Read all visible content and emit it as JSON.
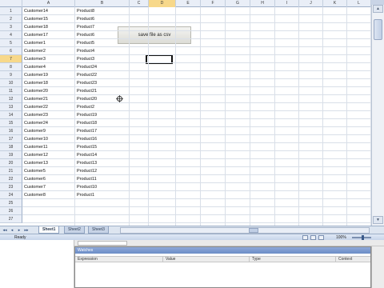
{
  "sheet": {
    "columns": [
      "A",
      "B",
      "C",
      "D",
      "E",
      "F",
      "G",
      "H",
      "I",
      "J",
      "K",
      "L"
    ],
    "active_column": "D",
    "rows": [
      "1",
      "2",
      "3",
      "4",
      "5",
      "6",
      "7",
      "8",
      "9",
      "10",
      "11",
      "12",
      "13",
      "14",
      "15",
      "16",
      "17",
      "18",
      "19",
      "20",
      "21",
      "22",
      "23",
      "24",
      "25",
      "26",
      "27"
    ],
    "active_row": "7",
    "data": [
      {
        "a": "Customer14",
        "b": "Product8"
      },
      {
        "a": "Customer15",
        "b": "Product6"
      },
      {
        "a": "Customer18",
        "b": "Product7"
      },
      {
        "a": "Customer17",
        "b": "Product6"
      },
      {
        "a": "Customer1",
        "b": "Product5"
      },
      {
        "a": "Customer2",
        "b": "Product4"
      },
      {
        "a": "Customer3",
        "b": "Product3"
      },
      {
        "a": "Customer4",
        "b": "Product24"
      },
      {
        "a": "Customer19",
        "b": "Product22"
      },
      {
        "a": "Customer18",
        "b": "Product23"
      },
      {
        "a": "Customer20",
        "b": "Product21"
      },
      {
        "a": "Customer21",
        "b": "Product20"
      },
      {
        "a": "Customer22",
        "b": "Product2"
      },
      {
        "a": "Customer23",
        "b": "Product19"
      },
      {
        "a": "Customer24",
        "b": "Product18"
      },
      {
        "a": "Customer9",
        "b": "Product17"
      },
      {
        "a": "Customer10",
        "b": "Product16"
      },
      {
        "a": "Customer11",
        "b": "Product15"
      },
      {
        "a": "Customer12",
        "b": "Product14"
      },
      {
        "a": "Customer13",
        "b": "Product13"
      },
      {
        "a": "Customer5",
        "b": "Product12"
      },
      {
        "a": "Customer6",
        "b": "Product11"
      },
      {
        "a": "Customer7",
        "b": "Product10"
      },
      {
        "a": "Customer8",
        "b": "Product1"
      }
    ],
    "button_label": "save file as csv"
  },
  "tabs": {
    "nav": [
      "◂◂",
      "◂",
      "▸",
      "▸▸"
    ],
    "items": [
      "Sheet1",
      "Sheet2",
      "Sheet3"
    ],
    "active": "Sheet1"
  },
  "status": {
    "ready": "Ready",
    "zoom": "100%"
  },
  "vba": {
    "watches_title": "Watches",
    "columns": [
      "Expression",
      "Value",
      "Type",
      "Context"
    ]
  },
  "colors": {
    "header_bg": "#e9eef7",
    "active_header": "#f7d88a",
    "watches_title_bg": "#6b8cc7"
  }
}
